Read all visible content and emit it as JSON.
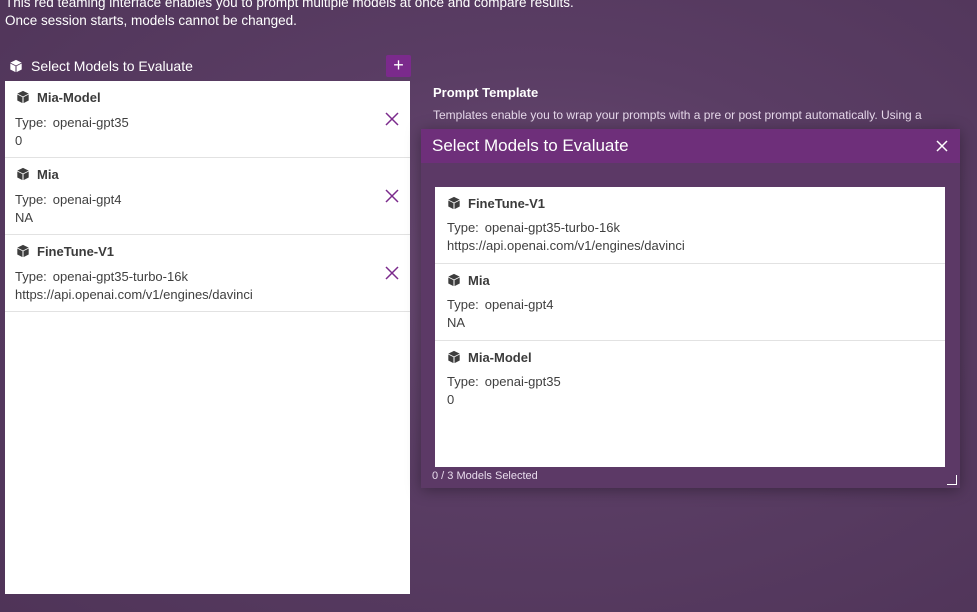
{
  "intro": {
    "line1": "This red teaming interface enables you to prompt multiple models at once and compare results.",
    "line2": "Once session starts, models cannot be changed."
  },
  "left": {
    "title": "Select Models to Evaluate",
    "add_label": "+",
    "models": [
      {
        "name": "Mia-Model",
        "type_label": "Type:",
        "type": "openai-gpt35",
        "extra": "0"
      },
      {
        "name": "Mia",
        "type_label": "Type:",
        "type": "openai-gpt4",
        "extra": "NA"
      },
      {
        "name": "FineTune-V1",
        "type_label": "Type:",
        "type": "openai-gpt35-turbo-16k",
        "extra": "https://api.openai.com/v1/engines/davinci"
      }
    ]
  },
  "prompt_template": {
    "title": "Prompt Template",
    "description": "Templates enable you to wrap your prompts with a pre or post prompt automatically. Using a"
  },
  "modal": {
    "title": "Select Models to Evaluate",
    "models": [
      {
        "name": "FineTune-V1",
        "type_label": "Type:",
        "type": "openai-gpt35-turbo-16k",
        "extra": "https://api.openai.com/v1/engines/davinci"
      },
      {
        "name": "Mia",
        "type_label": "Type:",
        "type": "openai-gpt4",
        "extra": "NA"
      },
      {
        "name": "Mia-Model",
        "type_label": "Type:",
        "type": "openai-gpt35",
        "extra": "0"
      }
    ],
    "selected_count": "0 / 3 Models Selected"
  },
  "colors": {
    "accent": "#7b2a8c",
    "modal_header": "#6e2f7a",
    "background": "#5a3d64"
  },
  "icons": {
    "model": "cube-icon",
    "remove": "close-icon",
    "add": "plus-icon"
  }
}
